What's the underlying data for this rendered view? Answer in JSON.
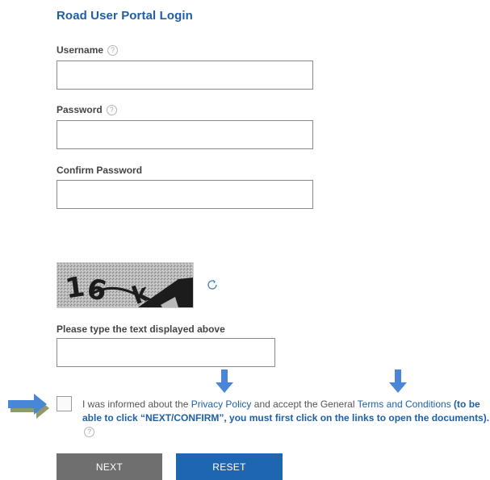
{
  "page": {
    "title": "Road User Portal Login"
  },
  "form": {
    "username_label": "Username",
    "username_value": "",
    "password_label": "Password",
    "password_value": "",
    "confirm_password_label": "Confirm Password",
    "confirm_password_value": "",
    "captcha_prompt": "Please type the text displayed above",
    "captcha_value": "",
    "help_icon": "?"
  },
  "captcha": {
    "text": "16 k"
  },
  "consent": {
    "text_before": "I was informed about the ",
    "privacy_link": "Privacy Policy",
    "text_middle": " and accept the General ",
    "terms_link": "Terms and Conditions",
    "bold_note": " (to be able to click “NEXT/CONFIRM”, you must first click on the links to open the documents).",
    "checked": false
  },
  "buttons": {
    "next_label": "NEXT",
    "reset_label": "RESET"
  },
  "colors": {
    "title": "#1f5fa6",
    "link": "#1f5fa6",
    "arrow": "#4a86d8",
    "next_button": "#6f6f6f",
    "reset_button": "#1f66b0"
  },
  "icons": {
    "help": "question-circle-icon",
    "refresh": "refresh-icon",
    "arrow_right": "arrow-right-icon",
    "arrow_down": "arrow-down-icon"
  }
}
